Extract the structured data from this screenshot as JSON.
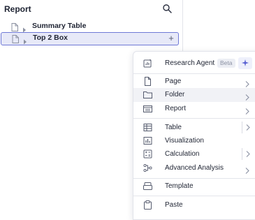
{
  "panel": {
    "title": "Report",
    "search_icon": "search-icon",
    "tree": [
      {
        "label": "Summary Table",
        "icon": "document-icon",
        "selected": false
      },
      {
        "label": "Top 2 Box",
        "icon": "document-icon",
        "selected": true,
        "action": "+"
      }
    ]
  },
  "menu": {
    "research_agent": {
      "label": "Research Agent",
      "badge": "Beta",
      "icon": "research-agent-icon",
      "action_icon": "sparkle-icon"
    },
    "page": {
      "label": "Page",
      "icon": "page-icon"
    },
    "folder": {
      "label": "Folder",
      "icon": "folder-icon"
    },
    "report": {
      "label": "Report",
      "icon": "report-icon"
    },
    "table": {
      "label": "Table",
      "icon": "table-icon"
    },
    "visualization": {
      "label": "Visualization",
      "icon": "chart-icon"
    },
    "calculation": {
      "label": "Calculation",
      "icon": "calculator-icon"
    },
    "advanced_analysis": {
      "label": "Advanced Analysis",
      "icon": "analysis-icon"
    },
    "template": {
      "label": "Template",
      "icon": "template-icon"
    },
    "paste": {
      "label": "Paste",
      "icon": "clipboard-icon"
    }
  },
  "colors": {
    "accent": "#6e78d6",
    "selection_bg": "#e7e9f8",
    "text": "#1f2433",
    "muted": "#8a90a2"
  }
}
